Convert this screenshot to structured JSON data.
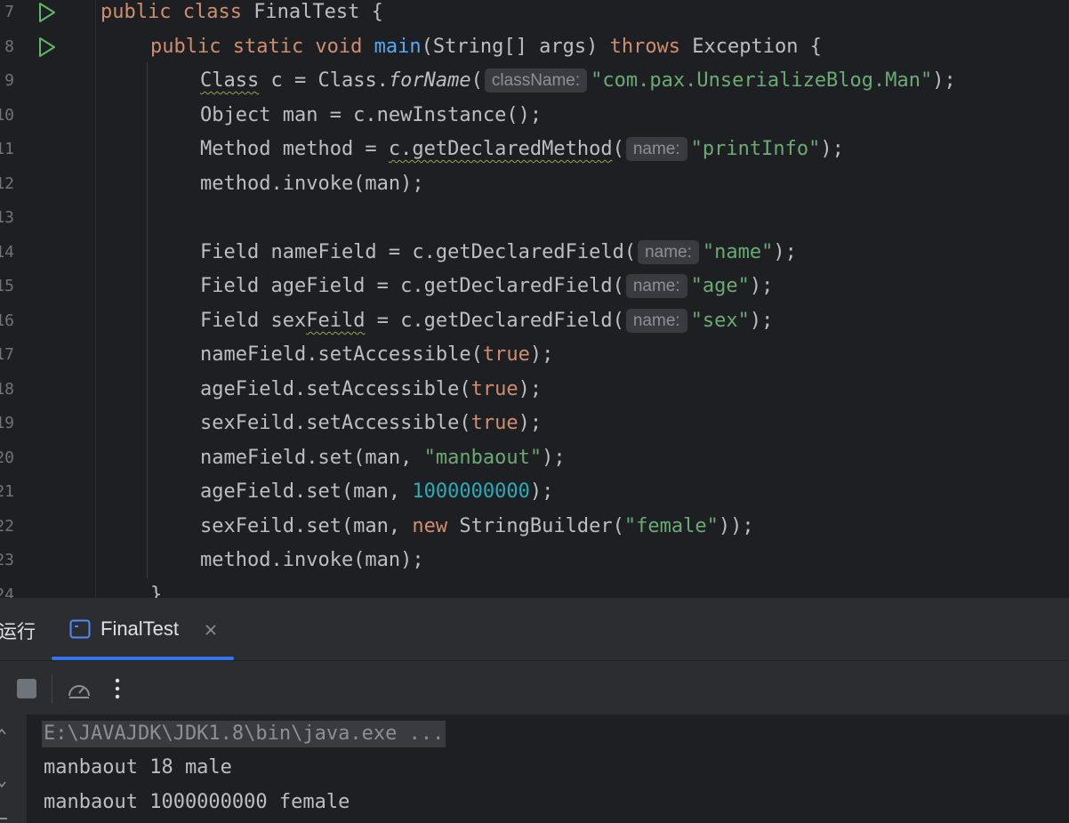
{
  "editor": {
    "line_numbers": [
      "7",
      "8",
      "9",
      "10",
      "11",
      "12",
      "13",
      "14",
      "15",
      "16",
      "17",
      "18",
      "19",
      "20",
      "21",
      "22",
      "23",
      "24"
    ],
    "code": {
      "l7": {
        "kw1": "public class ",
        "name": "FinalTest {"
      },
      "l8": {
        "kw1": "public static void ",
        "fn": "main",
        "rest1": "(String[] args) ",
        "kw2": "throws",
        "rest2": " Exception {"
      },
      "l9": {
        "w": "Class",
        "a": " c = Class.",
        "m": "forName",
        "b": "(",
        "hint": "className:",
        "s": "\"com.pax.UnserializeBlog.Man\"",
        "e": ");"
      },
      "l10": {
        "t": "Object man = c.newInstance();"
      },
      "l11": {
        "a": "Method method = ",
        "w": "c.getDeclaredMethod",
        "b": "(",
        "hint": "name:",
        "s": "\"printInfo\"",
        "e": ");"
      },
      "l12": {
        "t": "method.invoke(man);"
      },
      "l14": {
        "a": "Field nameField = c.getDeclaredField(",
        "hint": "name:",
        "s": "\"name\"",
        "e": ");"
      },
      "l15": {
        "a": "Field ageField = c.getDeclaredField(",
        "hint": "name:",
        "s": "\"age\"",
        "e": ");"
      },
      "l16": {
        "a": "Field sex",
        "w": "Feild",
        "b": " = c.getDeclaredField(",
        "hint": "name:",
        "s": "\"sex\"",
        "e": ");"
      },
      "l17": {
        "a": "nameField.setAccessible(",
        "k": "true",
        "e": ");"
      },
      "l18": {
        "a": "ageField.setAccessible(",
        "k": "true",
        "e": ");"
      },
      "l19": {
        "a": "sexFeild.setAccessible(",
        "k": "true",
        "e": ");"
      },
      "l20": {
        "a": "nameField.set(man, ",
        "s": "\"manbaout\"",
        "e": ");"
      },
      "l21": {
        "a": "ageField.set(man, ",
        "n": "1000000000",
        "e": ");"
      },
      "l22": {
        "a": "sexFeild.set(man, ",
        "k": "new",
        "b": " StringBuilder(",
        "s": "\"female\"",
        "e": "));"
      },
      "l23": {
        "t": "method.invoke(man);"
      },
      "l24": {
        "t": "}"
      }
    }
  },
  "run_window": {
    "side_label": "运行",
    "tab_title": "FinalTest",
    "tab_icon": "console-window-icon",
    "toolbar": {
      "stop": "stop-icon",
      "profiler": "speedometer-icon",
      "more": "more-vertical-icon"
    },
    "output": [
      "E:\\JAVAJDK\\JDK1.8\\bin\\java.exe ...",
      "manbaout 18 male",
      "manbaout 1000000000 female"
    ]
  },
  "colors": {
    "accent": "#3574f0",
    "run_green": "#5fb865",
    "keyword": "#cf8e6d",
    "string": "#6aab73",
    "number": "#2aacb8",
    "function": "#56a8f5"
  }
}
